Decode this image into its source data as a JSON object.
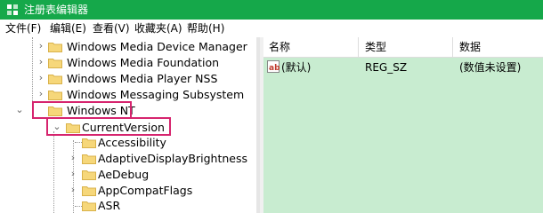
{
  "window": {
    "title": "注册表编辑器",
    "accent_color": "#15a84a"
  },
  "menu": [
    "文件(F)",
    "编辑(E)",
    "查看(V)",
    "收藏夹(A)",
    "帮助(H)"
  ],
  "tree": [
    {
      "label": "Windows Media Device Manager",
      "expander": "collapsed",
      "selected_highlight": false
    },
    {
      "label": "Windows Media Foundation",
      "expander": "collapsed",
      "selected_highlight": false
    },
    {
      "label": "Windows Media Player NSS",
      "expander": "collapsed",
      "selected_highlight": false
    },
    {
      "label": "Windows Messaging Subsystem",
      "expander": "collapsed",
      "selected_highlight": false
    },
    {
      "label": "Windows NT",
      "expander": "expanded",
      "selected_highlight": true
    },
    {
      "label": "CurrentVersion",
      "expander": "expanded",
      "selected_highlight": true
    },
    {
      "label": "Accessibility",
      "expander": "none",
      "selected_highlight": false
    },
    {
      "label": "AdaptiveDisplayBrightness",
      "expander": "collapsed",
      "selected_highlight": false
    },
    {
      "label": "AeDebug",
      "expander": "collapsed",
      "selected_highlight": false
    },
    {
      "label": "AppCompatFlags",
      "expander": "collapsed",
      "selected_highlight": false
    },
    {
      "label": "ASR",
      "expander": "none",
      "selected_highlight": false
    }
  ],
  "values_pane": {
    "columns": [
      "名称",
      "类型",
      "数据"
    ],
    "rows": [
      {
        "name": "(默认)",
        "type": "REG_SZ",
        "data": "(数值未设置)"
      }
    ],
    "background_color": "#c8ecd0"
  },
  "highlight_color": "#d6246e",
  "icons": {
    "app": "registry-editor-icon",
    "folder": "folder-icon",
    "value": "string-value-icon"
  }
}
